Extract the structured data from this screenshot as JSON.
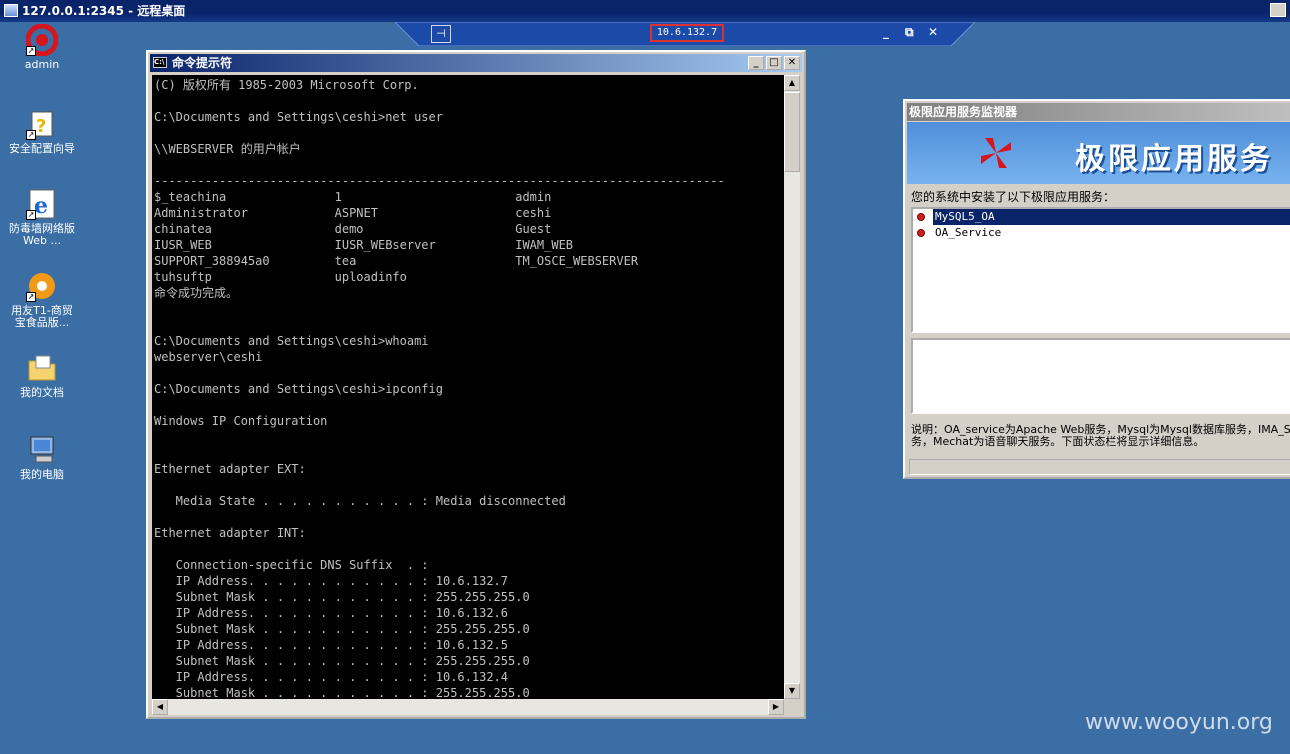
{
  "outer_window": {
    "title": "127.0.0.1:2345 - 远程桌面"
  },
  "connection_bar": {
    "ip": "10.6.132.7",
    "pin": "⊣",
    "minimize": "_",
    "restore": "⧉",
    "close": "✕"
  },
  "desktop_icons": [
    {
      "label": "admin"
    },
    {
      "label": "安全配置向导"
    },
    {
      "label": "防毒墙网络版 Web ..."
    },
    {
      "label": "用友T1-商贸宝食品版..."
    },
    {
      "label": "我的文档"
    },
    {
      "label": "我的电脑"
    }
  ],
  "cmd_window": {
    "title": "命令提示符",
    "output": "(C) 版权所有 1985-2003 Microsoft Corp.\n\nC:\\Documents and Settings\\ceshi>net user\n\n\\\\WEBSERVER 的用户帐户\n\n-------------------------------------------------------------------------------\n$_teachina               1                        admin\nAdministrator            ASPNET                   ceshi\nchinatea                 demo                     Guest\nIUSR_WEB                 IUSR_WEBserver           IWAM_WEB\nSUPPORT_388945a0         tea                      TM_OSCE_WEBSERVER\ntuhsuftp                 uploadinfo\n命令成功完成。\n\n\nC:\\Documents and Settings\\ceshi>whoami\nwebserver\\ceshi\n\nC:\\Documents and Settings\\ceshi>ipconfig\n\nWindows IP Configuration\n\n\nEthernet adapter EXT:\n\n   Media State . . . . . . . . . . . : Media disconnected\n\nEthernet adapter INT:\n\n   Connection-specific DNS Suffix  . :\n   IP Address. . . . . . . . . . . . : 10.6.132.7\n   Subnet Mask . . . . . . . . . . . : 255.255.255.0\n   IP Address. . . . . . . . . . . . : 10.6.132.6\n   Subnet Mask . . . . . . . . . . . : 255.255.255.0\n   IP Address. . . . . . . . . . . . : 10.6.132.5\n   Subnet Mask . . . . . . . . . . . : 255.255.255.0\n   IP Address. . . . . . . . . . . . : 10.6.132.4\n   Subnet Mask . . . . . . . . . . . : 255.255.255.0"
  },
  "monitor_window": {
    "title": "极限应用服务监视器",
    "banner": "极限应用服务",
    "prompt": "您的系统中安装了以下极限应用服务：",
    "services": [
      {
        "name": "MySQL5_OA",
        "selected": true
      },
      {
        "name": "OA_Service",
        "selected": false
      }
    ],
    "note": "说明：OA_service为Apache Web服务，Mysql为Mysql数据库服务，IMA_S\n务，Mechat为语音聊天服务。下面状态栏将显示详细信息。"
  },
  "watermark": "www.wooyun.org"
}
